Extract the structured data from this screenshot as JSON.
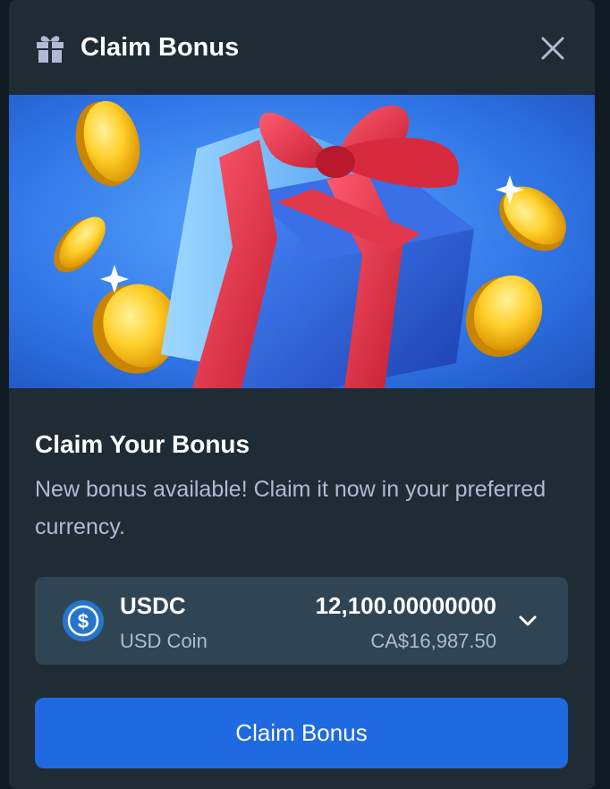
{
  "header": {
    "title": "Claim Bonus",
    "icon": "gift-icon",
    "close_icon": "close-icon"
  },
  "banner": {
    "image": "gift-box-with-coins-illustration"
  },
  "content": {
    "title": "Claim Your Bonus",
    "description": "New bonus available! Claim it now in your preferred currency."
  },
  "currency_select": {
    "icon": "usdc-coin-icon",
    "code": "USDC",
    "name": "USD Coin",
    "amount": "12,100.00000000",
    "fiat_value": "CA$16,987.50",
    "chevron_icon": "chevron-down-icon"
  },
  "actions": {
    "claim_label": "Claim Bonus"
  },
  "colors": {
    "modal_bg": "#1f2c36",
    "select_bg": "#2f4553",
    "primary": "#1f6ae0",
    "text_primary": "#ffffff",
    "text_secondary": "#b1bad3",
    "usdc_blue": "#2775ca"
  }
}
